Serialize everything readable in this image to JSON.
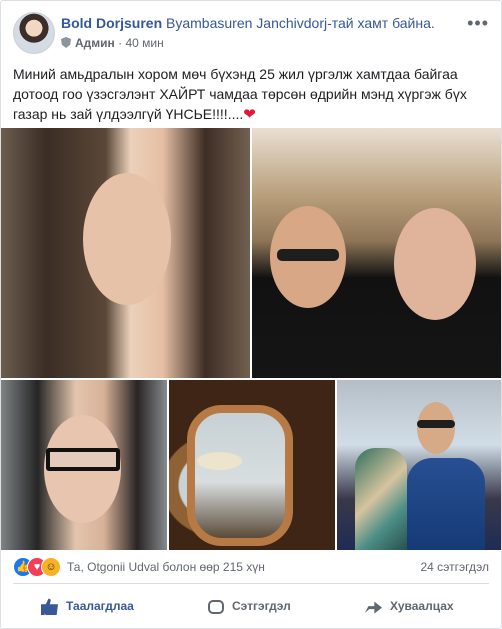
{
  "post": {
    "author": "Bold Dorjsuren",
    "with_text": "Byambasuren Janchivdorj-тай хамт байна.",
    "role": "Админ",
    "time": "40 мин",
    "text": "Миний амьдралын хором мөч бүхэнд 25 жил үргэлж хамтдаа байгаа дотоод гоо үзэсгэлэнт ХАЙРТ чамдаа төрсөн өдрийн мэнд хүргэж бүх газар нь зай үлдээлгүй ҮНСЬЕ!!!!....",
    "emoji": "❤"
  },
  "reactions": {
    "summary": "Та, Otgonii Udval болон өөр 215 хүн",
    "comments": "24 сэтгэгдэл",
    "icons": [
      "like-icon",
      "love-icon",
      "care-icon"
    ]
  },
  "actions": {
    "like": "Таалагдлаа",
    "comment": "Сэтгэгдэл",
    "share": "Хуваалцах"
  },
  "colors": {
    "link": "#365899",
    "like": "#385898",
    "love": "#f33e58",
    "muted": "#616770"
  }
}
